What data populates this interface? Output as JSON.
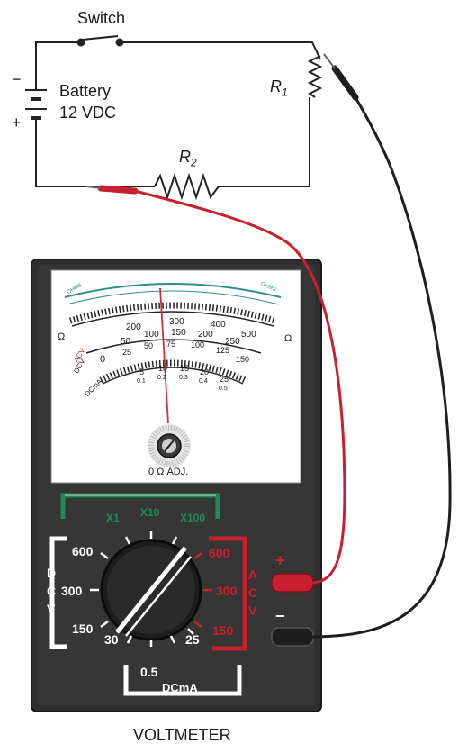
{
  "circuit": {
    "switch_label": "Switch",
    "battery_label": "Battery",
    "battery_voltage": "12 VDC",
    "minus_sign": "−",
    "plus_sign": "+",
    "r1_letter": "R",
    "r1_sub": "1",
    "r2_letter": "R",
    "r2_sub": "2"
  },
  "meter": {
    "title": "VOLTMETER",
    "zero_adjust": "0 Ω ADJ.",
    "scale_labels": {
      "dcv_scale": [
        "0",
        "200",
        "300",
        "400",
        "500"
      ],
      "acv_scale": [
        "50",
        "100",
        "150",
        "200",
        "250"
      ],
      "low_scale": [
        "25",
        "50",
        "75",
        "100",
        "125",
        "150"
      ],
      "dcma_scale": [
        "5",
        "10",
        "15",
        "20",
        "25"
      ],
      "dcma_sub": [
        "0.1",
        "0.2",
        "0.3",
        "0.4",
        "0.5"
      ],
      "acv_tag": "ACV",
      "dcv_tag": "DCV",
      "dcma_tag": "DCmA",
      "ohms_tag": "Ω",
      "ohms_scale_left": "OHMS",
      "ohms_scale_right": "OHMS"
    },
    "ohm_range_labels": [
      "X1",
      "X10",
      "X100"
    ],
    "dcv_ranges": [
      "600",
      "300",
      "150"
    ],
    "dcv_letters": [
      "D",
      "C",
      "V"
    ],
    "acv_ranges": [
      "600",
      "300",
      "150"
    ],
    "acv_letters": [
      "A",
      "C",
      "V"
    ],
    "dcma_ranges": [
      "30",
      "0.5",
      "25"
    ],
    "dcma_label": "DCmA",
    "jack_plus": "+",
    "jack_minus": "−",
    "colors": {
      "body": "#2f2f2f",
      "face": "#ffffff",
      "dc_bracket": "#ffffff",
      "ac_bracket": "#c8202e",
      "ohm_bracket": "#1f8a5a",
      "red_lead": "#c8202e",
      "black_lead": "#1e1e1e",
      "scale_teal": "#2e8f8a",
      "needle": "#d0303a"
    },
    "icons": [
      "selector-knob-icon",
      "zero-adjust-knob-icon"
    ]
  }
}
